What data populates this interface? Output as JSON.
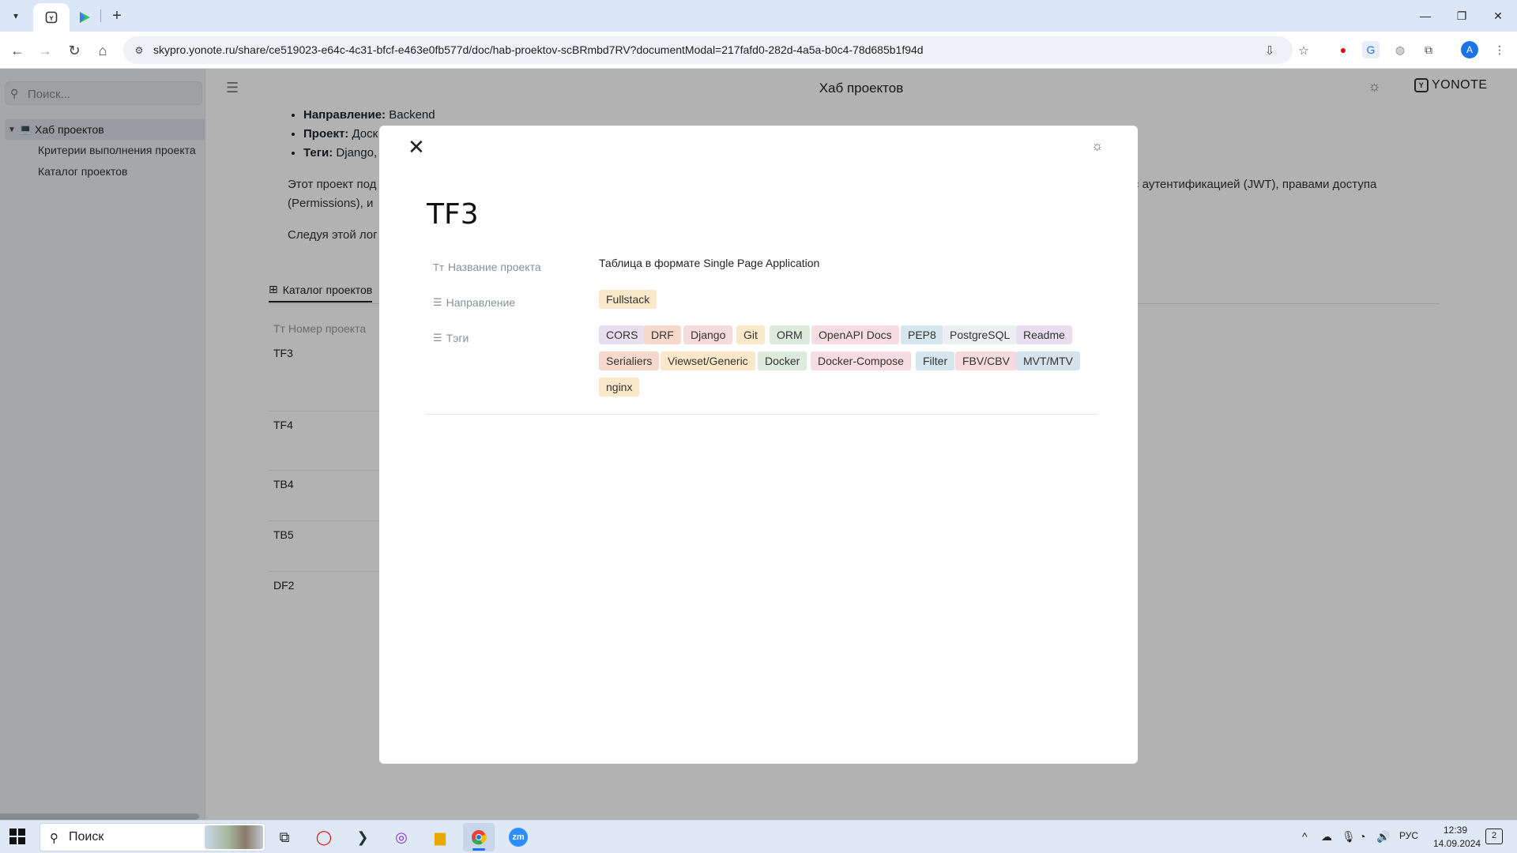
{
  "browser": {
    "url": "skypro.yonote.ru/share/ce519023-e64c-4c31-bfcf-e463e0fb577d/doc/hab-proektov-scBRmbd7RV?documentModal=217fafd0-282d-4a5a-b0c4-78d685b1f94d",
    "new_tab_glyph": "+",
    "profile_initial": "A",
    "icons": [
      "tab-list-icon",
      "yonote-tab-icon",
      "media-tab-icon",
      "back-icon",
      "forward-icon",
      "reload-icon",
      "home-icon",
      "site-info-icon",
      "install-icon",
      "bookmark-star-icon",
      "opera-icon",
      "translate-icon",
      "vpn-icon",
      "extensions-icon",
      "menu-dots-icon",
      "minimize-icon",
      "restore-icon",
      "close-window-icon"
    ]
  },
  "sidebar": {
    "search_placeholder": "Поиск...",
    "root": "Хаб проектов",
    "children": [
      "Критерии выполнения проекта",
      "Каталог проектов"
    ]
  },
  "header": {
    "title": "Хаб проектов",
    "brand": "YONOTE"
  },
  "document": {
    "bullets": [
      {
        "label": "Направление:",
        "value": "Backend"
      },
      {
        "label": "Проект:",
        "value": "Доск"
      },
      {
        "label": "Теги:",
        "value": "Django,"
      }
    ],
    "para1_left": "Этот проект под",
    "para1_right": "с аутентификацией (JWT), правами доступа",
    "para1_line2": "(Permissions), и",
    "para2_left": "Следуя этой лог",
    "catalog_tab": "Каталог проектов",
    "column_header": "Номер проекта",
    "rows": [
      "TF3",
      "TF4",
      "TB4",
      "TB5",
      "DF2"
    ]
  },
  "modal": {
    "title": "TF3",
    "properties": {
      "name_label": "Название проекта",
      "name_value": "Таблица в формате Single Page Application",
      "direction_label": "Направление",
      "direction_value": "Fullstack",
      "tags_label": "Тэги"
    },
    "tags": [
      {
        "label": "CORS",
        "color": "#e8def0"
      },
      {
        "label": "DRF",
        "color": "#f6d9cc"
      },
      {
        "label": "Django",
        "color": "#f7dadd"
      },
      {
        "label": "Git",
        "color": "#fbe8c8"
      },
      {
        "label": "ORM",
        "color": "#dcebdc"
      },
      {
        "label": "OpenAPI Docs",
        "color": "#f7dde3"
      },
      {
        "label": "PEP8",
        "color": "#d6e6ef"
      },
      {
        "label": "PostgreSQL",
        "color": "#eeeff1"
      },
      {
        "label": "Readme",
        "color": "#e8def0"
      },
      {
        "label": "Serialiers",
        "color": "#f6d9cc"
      },
      {
        "label": "Viewset/Generic",
        "color": "#fbe8c8"
      },
      {
        "label": "Docker",
        "color": "#dcebdc"
      },
      {
        "label": "Docker-Compose",
        "color": "#f7dde3"
      },
      {
        "label": "Filter",
        "color": "#d6e6ef"
      },
      {
        "label": "FBV/CBV",
        "color": "#f7dadd"
      },
      {
        "label": "MVT/MTV",
        "color": "#d6e3ec"
      },
      {
        "label": "nginx",
        "color": "#fbe8c8"
      }
    ],
    "direction_color": "#fbe8c8"
  },
  "taskbar": {
    "search_placeholder": "Поиск",
    "language": "РУС",
    "time": "12:39",
    "date": "14.09.2024",
    "notifications": "2",
    "apps": [
      "task-view-icon",
      "opera-app-icon",
      "terminal-app-icon",
      "instagram-app-icon",
      "file-explorer-icon",
      "chrome-app-icon",
      "zoom-app-icon"
    ],
    "zoom_label": "zm"
  }
}
